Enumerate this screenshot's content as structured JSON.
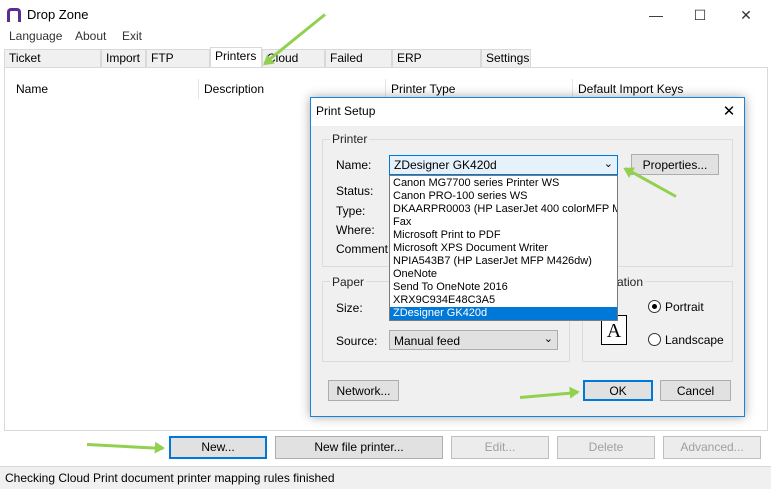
{
  "app": {
    "title": "Drop Zone"
  },
  "menu": [
    "Language",
    "About",
    "Exit"
  ],
  "tabs": [
    "Ticket Connection",
    "Import",
    "FTP Import",
    "Printers",
    "Cloud Print",
    "Failed Prints",
    "ERP Integration",
    "Settings"
  ],
  "active_tab": "Printers",
  "table": {
    "columns": [
      "Name",
      "Description",
      "Printer Type",
      "Default Import Keys"
    ]
  },
  "buttons": {
    "new": "New...",
    "new_file_printer": "New file printer...",
    "edit": "Edit...",
    "delete": "Delete",
    "advanced": "Advanced..."
  },
  "status": "Checking Cloud Print document printer mapping rules finished",
  "dialog": {
    "title": "Print Setup",
    "printer_group": "Printer",
    "name_label": "Name:",
    "selected_printer": "ZDesigner GK420d",
    "properties": "Properties...",
    "status_label": "Status:",
    "type_label": "Type:",
    "where_label": "Where:",
    "comment_label": "Comment:",
    "printers": [
      "Canon MG7700 series Printer WS",
      "Canon PRO-100 series WS",
      "DKAARPR0003 (HP LaserJet 400 colorMFP M4",
      "Fax",
      "Microsoft Print to PDF",
      "Microsoft XPS Document Writer",
      "NPIA543B7 (HP LaserJet MFP M426dw)",
      "OneNote",
      "Send To OneNote 2016",
      "XRX9C934E48C3A5",
      "ZDesigner GK420d"
    ],
    "paper_group": "Paper",
    "size_label": "Size:",
    "source_label": "Source:",
    "source_value": "Manual feed",
    "orientation_group": "ation",
    "portrait": "Portrait",
    "landscape": "Landscape",
    "orientation_icon_letter": "A",
    "network": "Network...",
    "ok": "OK",
    "cancel": "Cancel"
  },
  "colors": {
    "accent": "#0078d7",
    "arrow": "#92d050"
  }
}
